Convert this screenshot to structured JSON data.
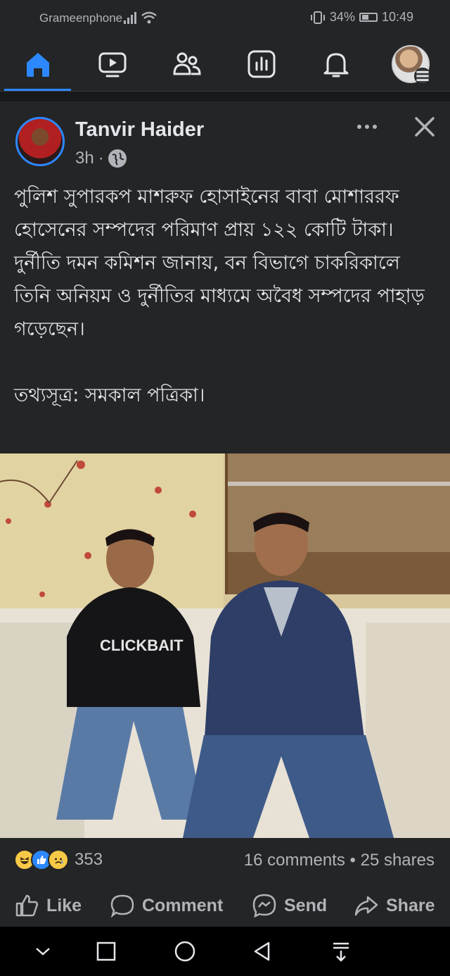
{
  "status_bar": {
    "carrier": "Grameenphone",
    "battery": "34%",
    "time": "10:49"
  },
  "nav": {
    "items": [
      {
        "name": "home",
        "icon": "home-icon",
        "active": true
      },
      {
        "name": "watch",
        "icon": "video-icon"
      },
      {
        "name": "friends",
        "icon": "friends-icon"
      },
      {
        "name": "dashboard",
        "icon": "dashboard-icon"
      },
      {
        "name": "notifications",
        "icon": "bell-icon"
      },
      {
        "name": "profile-menu",
        "icon": "menu-icon"
      }
    ],
    "accent": "#2d88ff"
  },
  "post": {
    "author": "Tanvir Haider",
    "time": "3h",
    "separator": "·",
    "privacy_icon": "globe-icon",
    "text": "পুলিশ সুপারকপ মাশরুফ হোসাইনের বাবা মোশাররফ হোসেনের সম্পদের পরিমাণ প্রায় ১২২ কোটি টাকা। দুর্নীতি দমন কমিশন জানায়, বন বিভাগে চাকরিকালে তিনি অনিয়ম ও দুর্নীতির মাধ্যমে অবৈধ সম্পদের পাহাড় গড়েছেন।\n\nতথ্যসূত্র: সমকাল পত্রিকা।",
    "photo_caption_text": "CLICKBAIT",
    "reaction_count": "353",
    "comments": "16 comments",
    "shares": "25 shares",
    "stats_separator": "•"
  },
  "actions": {
    "like": "Like",
    "comment": "Comment",
    "send": "Send",
    "share": "Share"
  },
  "colors": {
    "background": "#242526",
    "text": "#e4e6eb",
    "muted": "#b0b3b8"
  }
}
